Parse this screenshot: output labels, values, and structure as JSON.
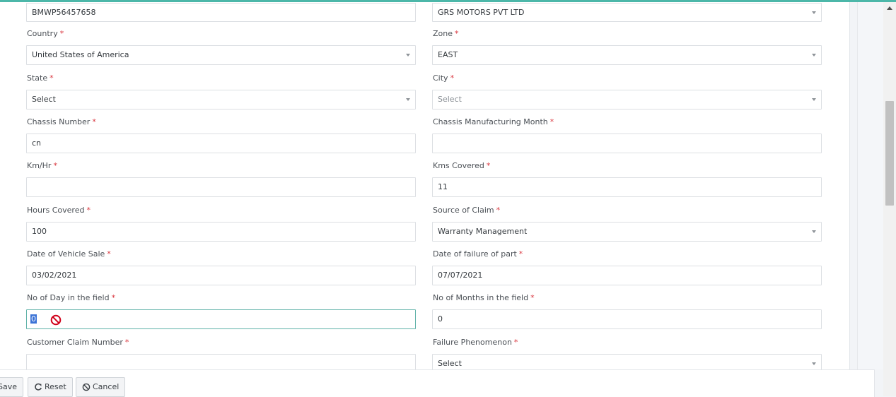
{
  "form": {
    "left": [
      {
        "id": "registration",
        "label": "",
        "required": false,
        "type": "text",
        "value": "BMWP56457658"
      },
      {
        "id": "country",
        "label": "Country",
        "required": true,
        "type": "select",
        "value": "United States of America"
      },
      {
        "id": "state",
        "label": "State",
        "required": true,
        "type": "select",
        "value": "Select"
      },
      {
        "id": "chassis-number",
        "label": "Chassis Number",
        "required": true,
        "type": "text",
        "value": "cn"
      },
      {
        "id": "km-hr",
        "label": "Km/Hr",
        "required": true,
        "type": "text",
        "value": ""
      },
      {
        "id": "hours-covered",
        "label": "Hours Covered",
        "required": true,
        "type": "text",
        "value": "100"
      },
      {
        "id": "date-of-vehicle-sale",
        "label": "Date of Vehicle Sale",
        "required": true,
        "type": "text",
        "value": "03/02/2021"
      },
      {
        "id": "no-of-day-in-field",
        "label": "No of Day in the field",
        "required": true,
        "type": "text",
        "value": "0",
        "focused": true
      },
      {
        "id": "customer-claim-number",
        "label": "Customer Claim Number",
        "required": true,
        "type": "text",
        "value": ""
      }
    ],
    "right": [
      {
        "id": "dealer",
        "label": "",
        "required": false,
        "type": "select",
        "value": "GRS MOTORS PVT LTD"
      },
      {
        "id": "zone",
        "label": "Zone",
        "required": true,
        "type": "select",
        "value": "EAST"
      },
      {
        "id": "city",
        "label": "City",
        "required": true,
        "type": "select",
        "value": "Select",
        "placeholder": true
      },
      {
        "id": "chassis-manufacturing-month",
        "label": "Chassis Manufacturing Month",
        "required": true,
        "type": "text",
        "value": ""
      },
      {
        "id": "kms-covered",
        "label": "Kms Covered",
        "required": true,
        "type": "text",
        "value": "11"
      },
      {
        "id": "source-of-claim",
        "label": "Source of Claim",
        "required": true,
        "type": "select",
        "value": "Warranty Management"
      },
      {
        "id": "date-of-failure-of-part",
        "label": "Date of failure of part",
        "required": true,
        "type": "text",
        "value": "07/07/2021"
      },
      {
        "id": "no-of-months-in-field",
        "label": "No of Months in the field",
        "required": true,
        "type": "text",
        "value": "0"
      },
      {
        "id": "failure-phenomenon",
        "label": "Failure Phenomenon",
        "required": true,
        "type": "select",
        "value": "Select"
      }
    ],
    "required_marker": "*"
  },
  "footer": {
    "save_label": "Save",
    "reset_label": "Reset",
    "cancel_label": "Cancel"
  },
  "icons": {
    "blocked": "no-entry-icon",
    "reset": "refresh-icon",
    "cancel": "ban-icon"
  },
  "colors": {
    "accent": "#4cb7a9",
    "required": "#d9363e",
    "blocked": "#d0021b",
    "selection": "#3b73d6"
  }
}
